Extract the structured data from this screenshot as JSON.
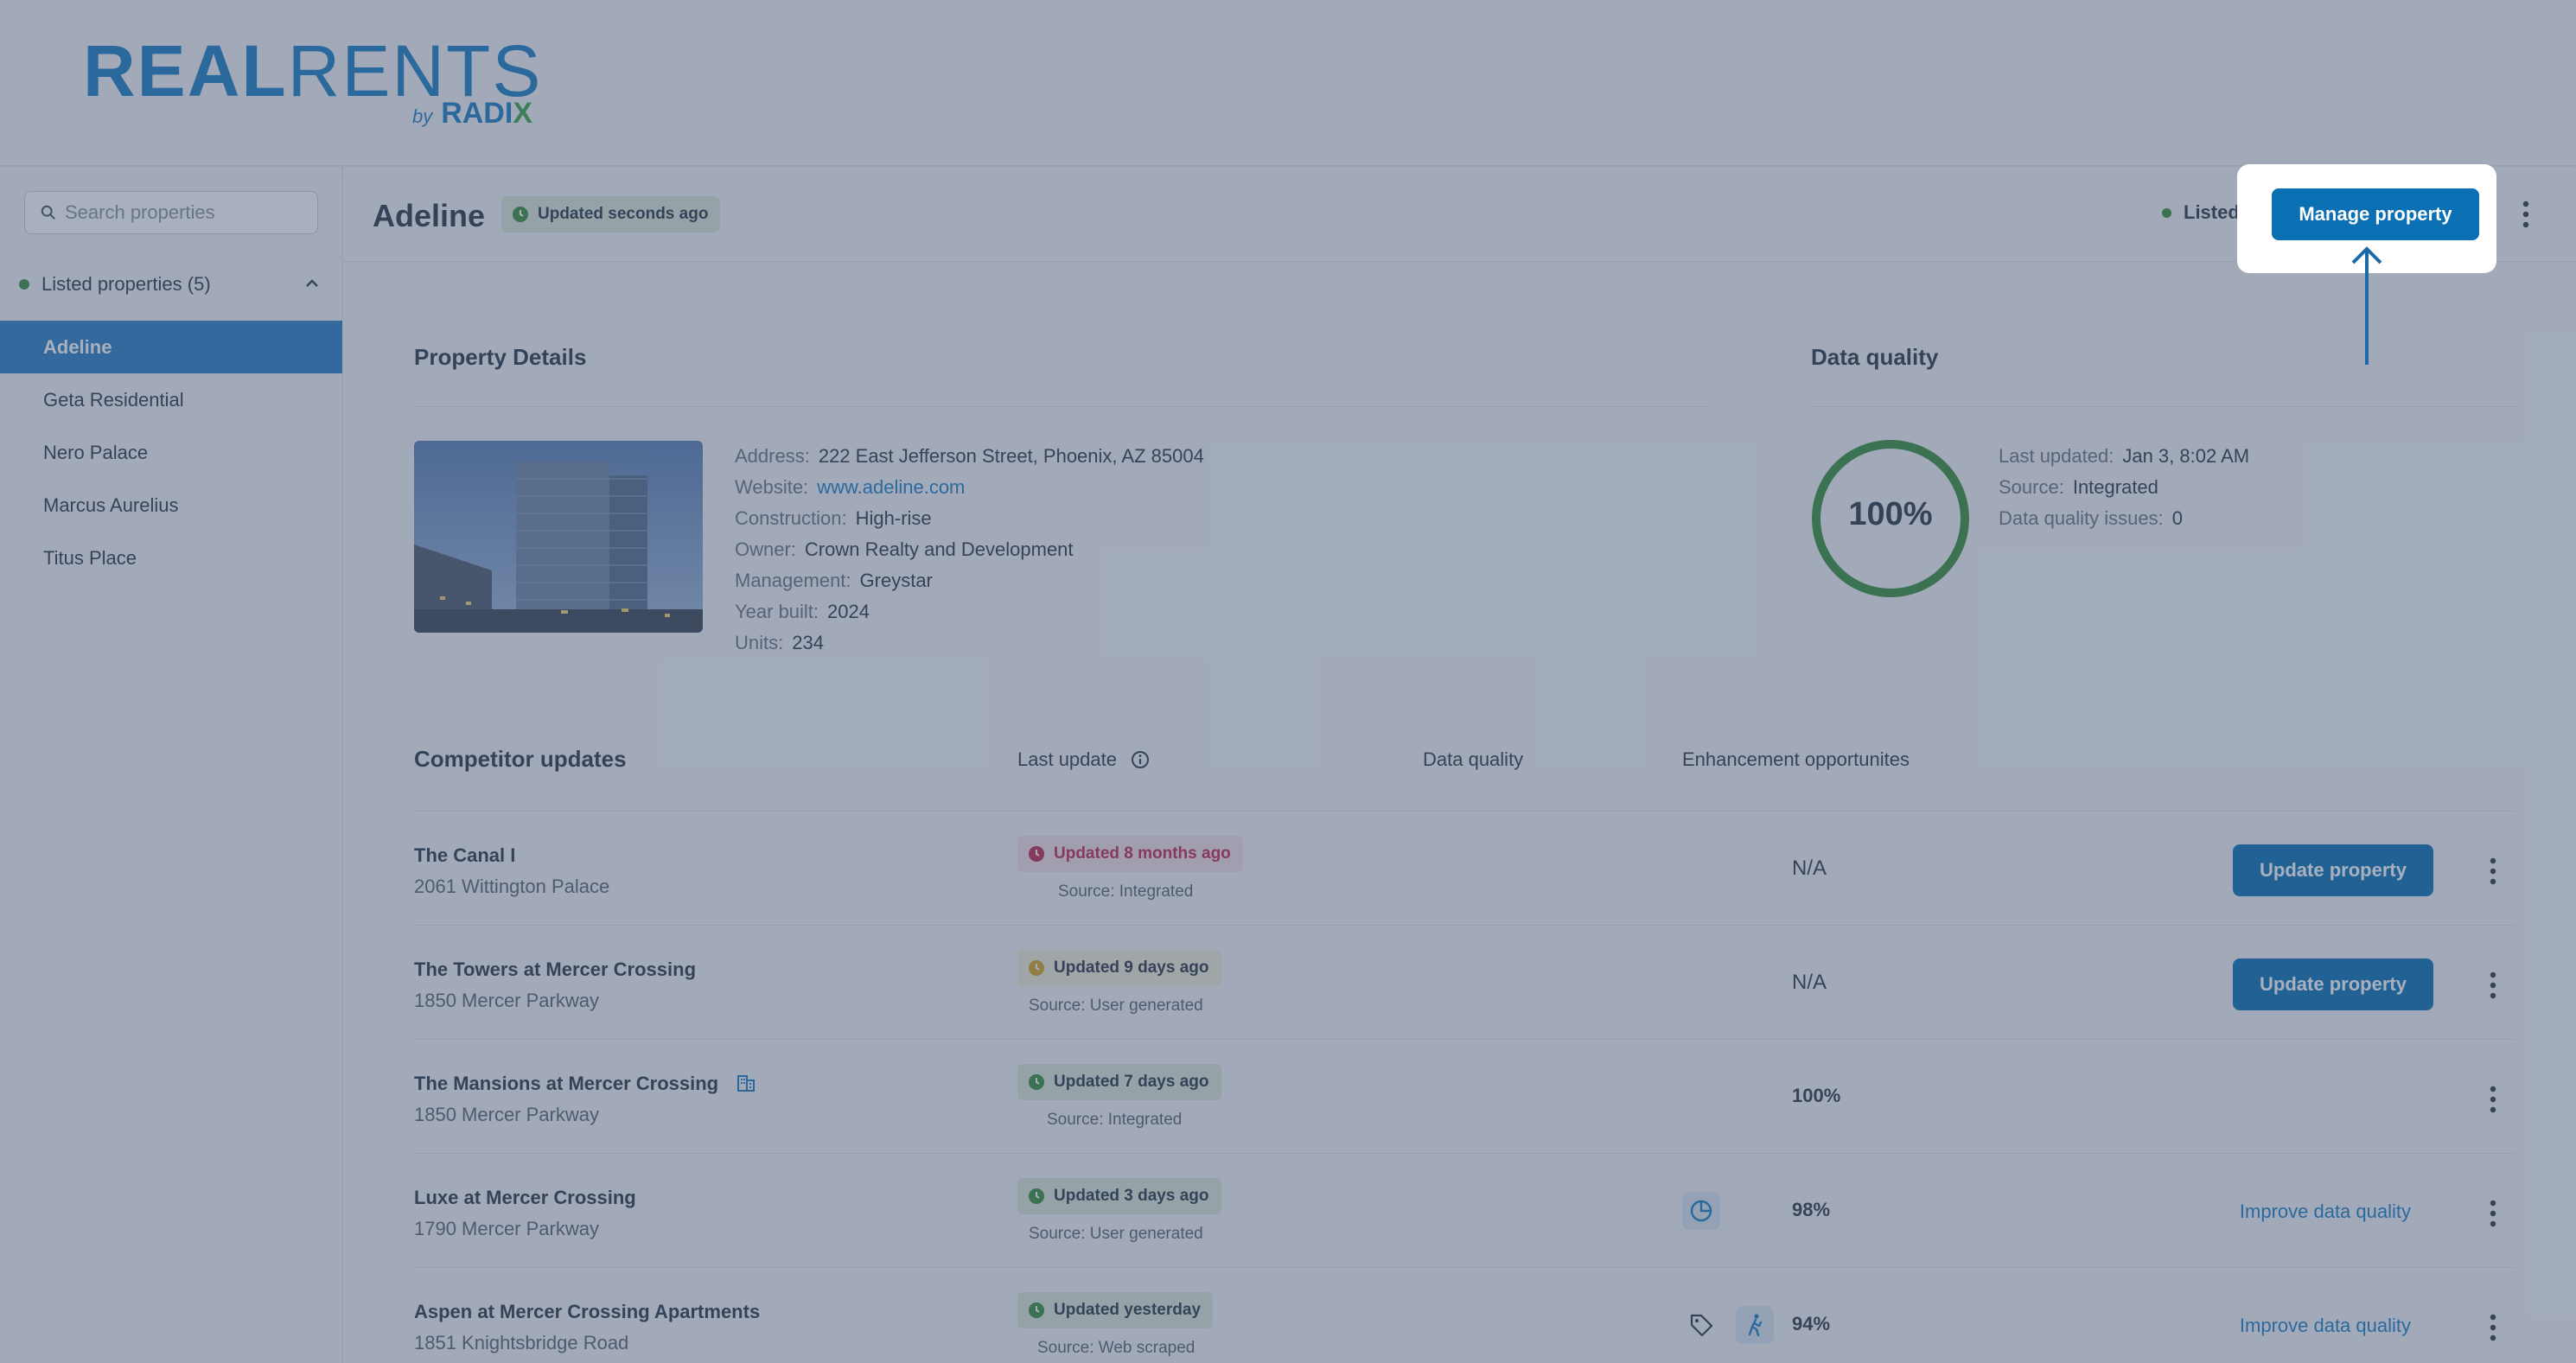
{
  "brand": {
    "name_bold": "REAL",
    "name_thin": "RENTS",
    "sub_by": "by",
    "sub_name": "RADI",
    "sub_x": "X"
  },
  "colors": {
    "primary": "#0a6fb3",
    "link": "#1d7fc4",
    "green": "#3a8f3a",
    "red": "#c2284d",
    "overlay": "rgba(62,80,110,0.45)"
  },
  "sidebar": {
    "search_placeholder": "Search properties",
    "group_label": "Listed properties (5)",
    "items": [
      {
        "label": "Adeline",
        "active": true
      },
      {
        "label": "Geta Residential"
      },
      {
        "label": "Nero Palace"
      },
      {
        "label": "Marcus Aurelius"
      },
      {
        "label": "Titus Place"
      }
    ]
  },
  "header": {
    "title": "Adeline",
    "updated": "Updated seconds ago",
    "status": "Listed",
    "manage_button": "Manage property"
  },
  "property_details": {
    "title": "Property Details",
    "address_label": "Address:",
    "address": "222 East Jefferson Street, Phoenix, AZ 85004",
    "website_label": "Website:",
    "website": "www.adeline.com",
    "construction_label": "Construction:",
    "construction": "High-rise",
    "owner_label": "Owner:",
    "owner": "Crown Realty and Development",
    "management_label": "Management:",
    "management": "Greystar",
    "year_label": "Year built:",
    "year": "2024",
    "units_label": "Units:",
    "units": "234"
  },
  "data_quality": {
    "title": "Data quality",
    "percent": "100%",
    "percent_value": 100,
    "last_updated_label": "Last updated:",
    "last_updated": "Jan 3, 8:02 AM",
    "source_label": "Source:",
    "source": "Integrated",
    "issues_label": "Data quality issues:",
    "issues": "0"
  },
  "competitors": {
    "title": "Competitor updates",
    "col_last_update": "Last update",
    "col_data_quality": "Data quality",
    "col_enhancement": "Enhancement opportunites",
    "rows": [
      {
        "name": "The Canal I",
        "address": "2061 Wittington Palace",
        "updated": "Updated 8 months ago",
        "source": "Source: Integrated",
        "quality": "N/A",
        "action": "Update property"
      },
      {
        "name": "The Towers at Mercer Crossing",
        "address": "1850 Mercer Parkway",
        "updated": "Updated 9 days ago",
        "source": "Source: User generated",
        "quality": "N/A",
        "action": "Update property"
      },
      {
        "name": "The Mansions at Mercer Crossing",
        "address": "1850 Mercer Parkway",
        "updated": "Updated 7 days ago",
        "source": "Source: Integrated",
        "quality": "100%",
        "action": ""
      },
      {
        "name": "Luxe at Mercer Crossing",
        "address": "1790 Mercer Parkway",
        "updated": "Updated 3 days ago",
        "source": "Source: User generated",
        "quality": "98%",
        "action": "Improve data quality"
      },
      {
        "name": "Aspen at Mercer Crossing Apartments",
        "address": "1851 Knightsbridge Road",
        "updated": "Updated yesterday",
        "source": "Source: Web scraped",
        "quality": "94%",
        "action": "Improve data quality"
      }
    ]
  }
}
